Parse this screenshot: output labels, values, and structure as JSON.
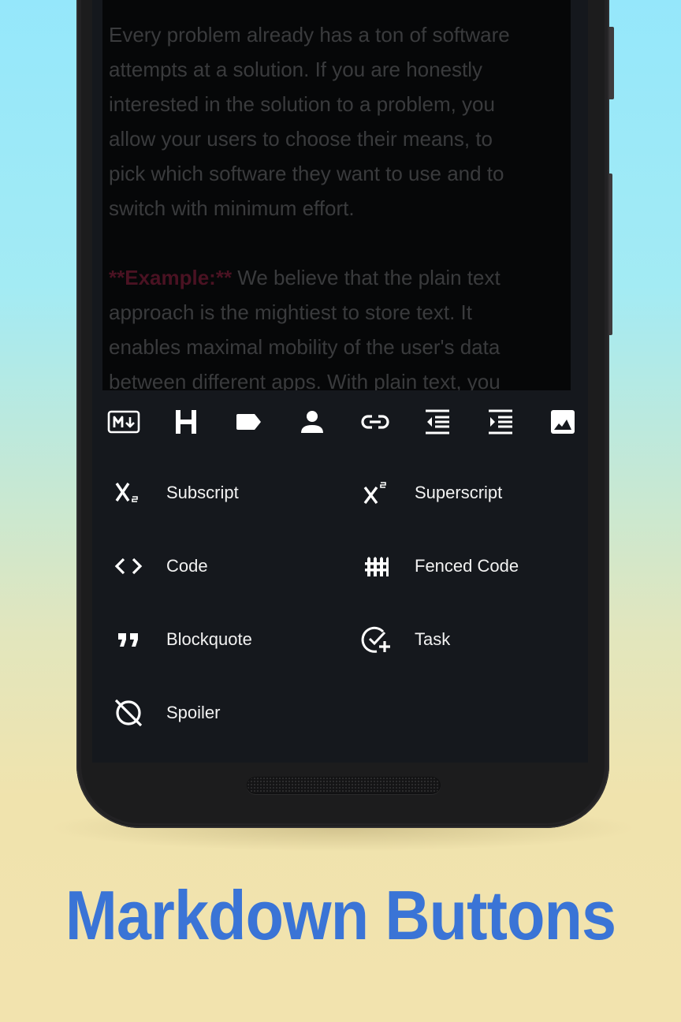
{
  "editor": {
    "paragraph1": [
      "Every problem already has a ton of software",
      "attempts at a solution. If you are honestly",
      "interested in the solution to a problem, you",
      "allow your users to choose their means, to",
      "pick which software they want to use and to",
      "switch with minimum effort."
    ],
    "paragraph2_bold": "**Example:**",
    "paragraph2": [
      " We believe that the plain text",
      "approach is the mightiest to store text. It",
      "enables maximal mobility of the user's data",
      "between different apps. With plain text, you"
    ]
  },
  "toolbar": {
    "buttons": [
      {
        "name": "markdown-icon",
        "label": "Markdown"
      },
      {
        "name": "heading-icon",
        "label": "Heading"
      },
      {
        "name": "label-icon",
        "label": "Tag"
      },
      {
        "name": "person-icon",
        "label": "Mention"
      },
      {
        "name": "link-icon",
        "label": "Link"
      },
      {
        "name": "indent-decrease-icon",
        "label": "Unindent"
      },
      {
        "name": "indent-increase-icon",
        "label": "Indent"
      },
      {
        "name": "image-icon",
        "label": "Image"
      }
    ]
  },
  "menu": {
    "items": [
      {
        "label": "Subscript",
        "icon": "subscript-icon"
      },
      {
        "label": "Superscript",
        "icon": "superscript-icon"
      },
      {
        "label": "Code",
        "icon": "code-icon"
      },
      {
        "label": "Fenced Code",
        "icon": "fence-icon"
      },
      {
        "label": "Blockquote",
        "icon": "quote-icon"
      },
      {
        "label": "Task",
        "icon": "task-add-icon"
      },
      {
        "label": "Spoiler",
        "icon": "spoiler-icon"
      }
    ]
  },
  "headline": "Markdown Buttons",
  "colors": {
    "headline": "#3a74d6",
    "bold_markup": "#4a1222",
    "screen_bg": "#15181d"
  }
}
